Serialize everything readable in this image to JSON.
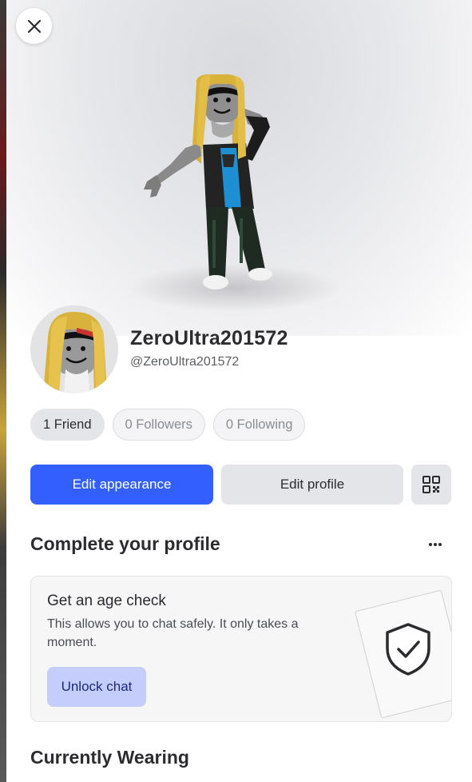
{
  "profile": {
    "display_name": "ZeroUltra201572",
    "username": "@ZeroUltra201572"
  },
  "stats": [
    {
      "label": "1 Friend"
    },
    {
      "label": "0 Followers"
    },
    {
      "label": "0 Following"
    }
  ],
  "actions": {
    "edit_appearance": "Edit appearance",
    "edit_profile": "Edit profile"
  },
  "complete_profile": {
    "title": "Complete your profile",
    "card": {
      "title": "Get an age check",
      "description": "This allows you to chat safely. It only takes a moment.",
      "button": "Unlock chat"
    }
  },
  "currently_wearing": {
    "title": "Currently Wearing"
  },
  "colors": {
    "primary": "#335fff",
    "secondary": "#e4e5e8",
    "unlock_bg": "#c4cdfb"
  },
  "icons": [
    "close-icon",
    "qr-code-icon",
    "more-horizontal-icon",
    "shield-check-icon"
  ]
}
